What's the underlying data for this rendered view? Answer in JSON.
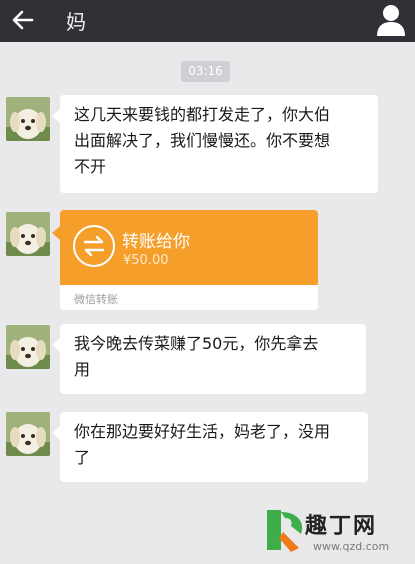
{
  "header": {
    "title": "妈",
    "back_icon": "arrow-left-icon",
    "profile_icon": "person-icon"
  },
  "timestamp": "03:16",
  "messages": [
    {
      "type": "text",
      "lines": [
        "这几天来要钱的都打发走了，你大伯",
        "出面解决了，我们慢慢还。你不要想",
        "不开"
      ]
    },
    {
      "type": "transfer",
      "title": "转账给你",
      "amount": "¥50.00",
      "footer": "微信转账",
      "icon": "transfer-arrows-icon"
    },
    {
      "type": "text",
      "lines": [
        "我今晚去传菜赚了50元，你先拿去",
        "用"
      ]
    },
    {
      "type": "text",
      "lines": [
        "你在那边要好好生活，妈老了，没用",
        "了"
      ]
    }
  ],
  "watermark": {
    "text": "趣丁网",
    "url": "www.qzd.com"
  },
  "colors": {
    "topbar": "#2f3136",
    "background": "#e9e9ec",
    "bubble": "#ffffff",
    "transfer": "#f59f2a"
  }
}
